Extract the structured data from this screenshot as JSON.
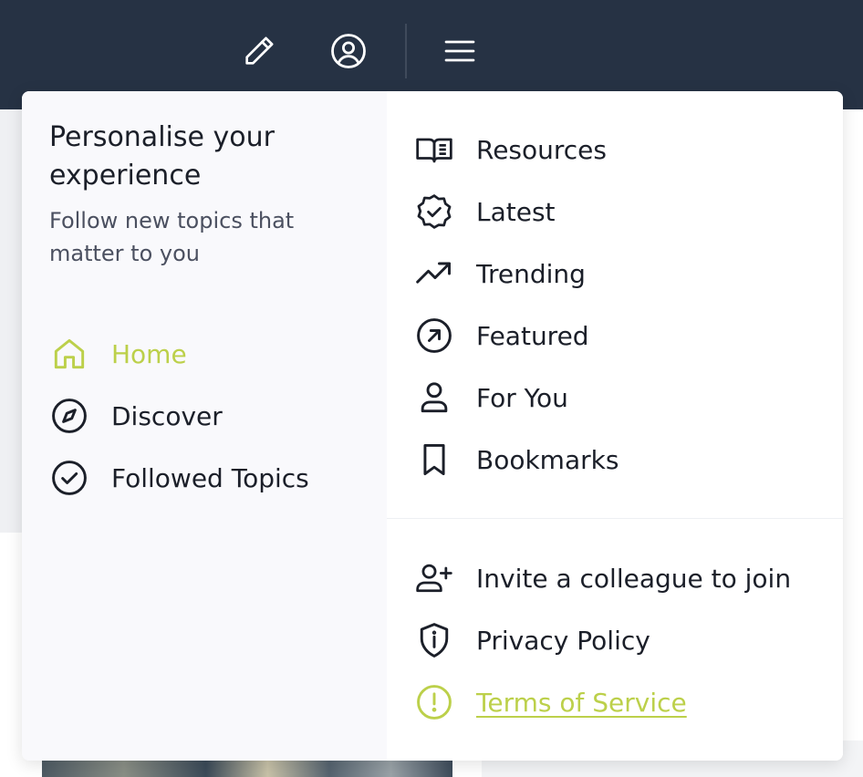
{
  "header": {
    "icons": [
      "pencil-icon",
      "user-circle-icon",
      "hamburger-menu-icon"
    ]
  },
  "menu": {
    "personalise": {
      "title": "Personalise your experience",
      "subtitle": "Follow new topics that matter to you"
    },
    "left_nav": [
      {
        "label": "Home",
        "icon": "home-icon",
        "active": true
      },
      {
        "label": "Discover",
        "icon": "compass-icon",
        "active": false
      },
      {
        "label": "Followed Topics",
        "icon": "check-circle-icon",
        "active": false
      }
    ],
    "right_nav": [
      {
        "label": "Resources",
        "icon": "book-open-icon"
      },
      {
        "label": "Latest",
        "icon": "badge-check-icon"
      },
      {
        "label": "Trending",
        "icon": "trending-up-icon"
      },
      {
        "label": "Featured",
        "icon": "arrow-up-right-circle-icon"
      },
      {
        "label": "For You",
        "icon": "user-icon"
      },
      {
        "label": "Bookmarks",
        "icon": "bookmark-icon"
      }
    ],
    "secondary_nav": [
      {
        "label": "Invite a colleague to join",
        "icon": "user-plus-icon"
      },
      {
        "label": "Privacy Policy",
        "icon": "shield-icon"
      },
      {
        "label": "Terms of Service",
        "icon": "alert-circle-icon",
        "link": true
      }
    ]
  },
  "colors": {
    "header_bg": "#263244",
    "accent": "#bcd04a",
    "text": "#1b1f29",
    "muted_text": "#4b5060",
    "panel_left_bg": "#f9f9fc"
  }
}
